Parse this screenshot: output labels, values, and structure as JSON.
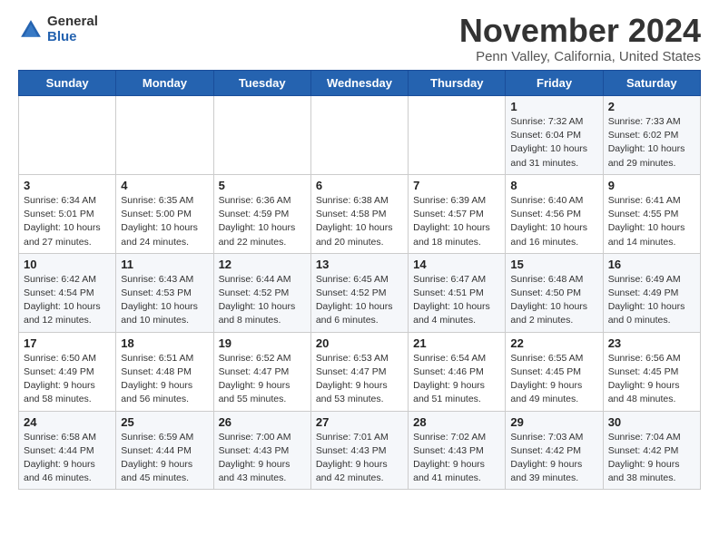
{
  "logo": {
    "general": "General",
    "blue": "Blue"
  },
  "title": "November 2024",
  "subtitle": "Penn Valley, California, United States",
  "days_of_week": [
    "Sunday",
    "Monday",
    "Tuesday",
    "Wednesday",
    "Thursday",
    "Friday",
    "Saturday"
  ],
  "weeks": [
    [
      {
        "day": "",
        "info": ""
      },
      {
        "day": "",
        "info": ""
      },
      {
        "day": "",
        "info": ""
      },
      {
        "day": "",
        "info": ""
      },
      {
        "day": "",
        "info": ""
      },
      {
        "day": "1",
        "info": "Sunrise: 7:32 AM\nSunset: 6:04 PM\nDaylight: 10 hours and 31 minutes."
      },
      {
        "day": "2",
        "info": "Sunrise: 7:33 AM\nSunset: 6:02 PM\nDaylight: 10 hours and 29 minutes."
      }
    ],
    [
      {
        "day": "3",
        "info": "Sunrise: 6:34 AM\nSunset: 5:01 PM\nDaylight: 10 hours and 27 minutes."
      },
      {
        "day": "4",
        "info": "Sunrise: 6:35 AM\nSunset: 5:00 PM\nDaylight: 10 hours and 24 minutes."
      },
      {
        "day": "5",
        "info": "Sunrise: 6:36 AM\nSunset: 4:59 PM\nDaylight: 10 hours and 22 minutes."
      },
      {
        "day": "6",
        "info": "Sunrise: 6:38 AM\nSunset: 4:58 PM\nDaylight: 10 hours and 20 minutes."
      },
      {
        "day": "7",
        "info": "Sunrise: 6:39 AM\nSunset: 4:57 PM\nDaylight: 10 hours and 18 minutes."
      },
      {
        "day": "8",
        "info": "Sunrise: 6:40 AM\nSunset: 4:56 PM\nDaylight: 10 hours and 16 minutes."
      },
      {
        "day": "9",
        "info": "Sunrise: 6:41 AM\nSunset: 4:55 PM\nDaylight: 10 hours and 14 minutes."
      }
    ],
    [
      {
        "day": "10",
        "info": "Sunrise: 6:42 AM\nSunset: 4:54 PM\nDaylight: 10 hours and 12 minutes."
      },
      {
        "day": "11",
        "info": "Sunrise: 6:43 AM\nSunset: 4:53 PM\nDaylight: 10 hours and 10 minutes."
      },
      {
        "day": "12",
        "info": "Sunrise: 6:44 AM\nSunset: 4:52 PM\nDaylight: 10 hours and 8 minutes."
      },
      {
        "day": "13",
        "info": "Sunrise: 6:45 AM\nSunset: 4:52 PM\nDaylight: 10 hours and 6 minutes."
      },
      {
        "day": "14",
        "info": "Sunrise: 6:47 AM\nSunset: 4:51 PM\nDaylight: 10 hours and 4 minutes."
      },
      {
        "day": "15",
        "info": "Sunrise: 6:48 AM\nSunset: 4:50 PM\nDaylight: 10 hours and 2 minutes."
      },
      {
        "day": "16",
        "info": "Sunrise: 6:49 AM\nSunset: 4:49 PM\nDaylight: 10 hours and 0 minutes."
      }
    ],
    [
      {
        "day": "17",
        "info": "Sunrise: 6:50 AM\nSunset: 4:49 PM\nDaylight: 9 hours and 58 minutes."
      },
      {
        "day": "18",
        "info": "Sunrise: 6:51 AM\nSunset: 4:48 PM\nDaylight: 9 hours and 56 minutes."
      },
      {
        "day": "19",
        "info": "Sunrise: 6:52 AM\nSunset: 4:47 PM\nDaylight: 9 hours and 55 minutes."
      },
      {
        "day": "20",
        "info": "Sunrise: 6:53 AM\nSunset: 4:47 PM\nDaylight: 9 hours and 53 minutes."
      },
      {
        "day": "21",
        "info": "Sunrise: 6:54 AM\nSunset: 4:46 PM\nDaylight: 9 hours and 51 minutes."
      },
      {
        "day": "22",
        "info": "Sunrise: 6:55 AM\nSunset: 4:45 PM\nDaylight: 9 hours and 49 minutes."
      },
      {
        "day": "23",
        "info": "Sunrise: 6:56 AM\nSunset: 4:45 PM\nDaylight: 9 hours and 48 minutes."
      }
    ],
    [
      {
        "day": "24",
        "info": "Sunrise: 6:58 AM\nSunset: 4:44 PM\nDaylight: 9 hours and 46 minutes."
      },
      {
        "day": "25",
        "info": "Sunrise: 6:59 AM\nSunset: 4:44 PM\nDaylight: 9 hours and 45 minutes."
      },
      {
        "day": "26",
        "info": "Sunrise: 7:00 AM\nSunset: 4:43 PM\nDaylight: 9 hours and 43 minutes."
      },
      {
        "day": "27",
        "info": "Sunrise: 7:01 AM\nSunset: 4:43 PM\nDaylight: 9 hours and 42 minutes."
      },
      {
        "day": "28",
        "info": "Sunrise: 7:02 AM\nSunset: 4:43 PM\nDaylight: 9 hours and 41 minutes."
      },
      {
        "day": "29",
        "info": "Sunrise: 7:03 AM\nSunset: 4:42 PM\nDaylight: 9 hours and 39 minutes."
      },
      {
        "day": "30",
        "info": "Sunrise: 7:04 AM\nSunset: 4:42 PM\nDaylight: 9 hours and 38 minutes."
      }
    ]
  ]
}
